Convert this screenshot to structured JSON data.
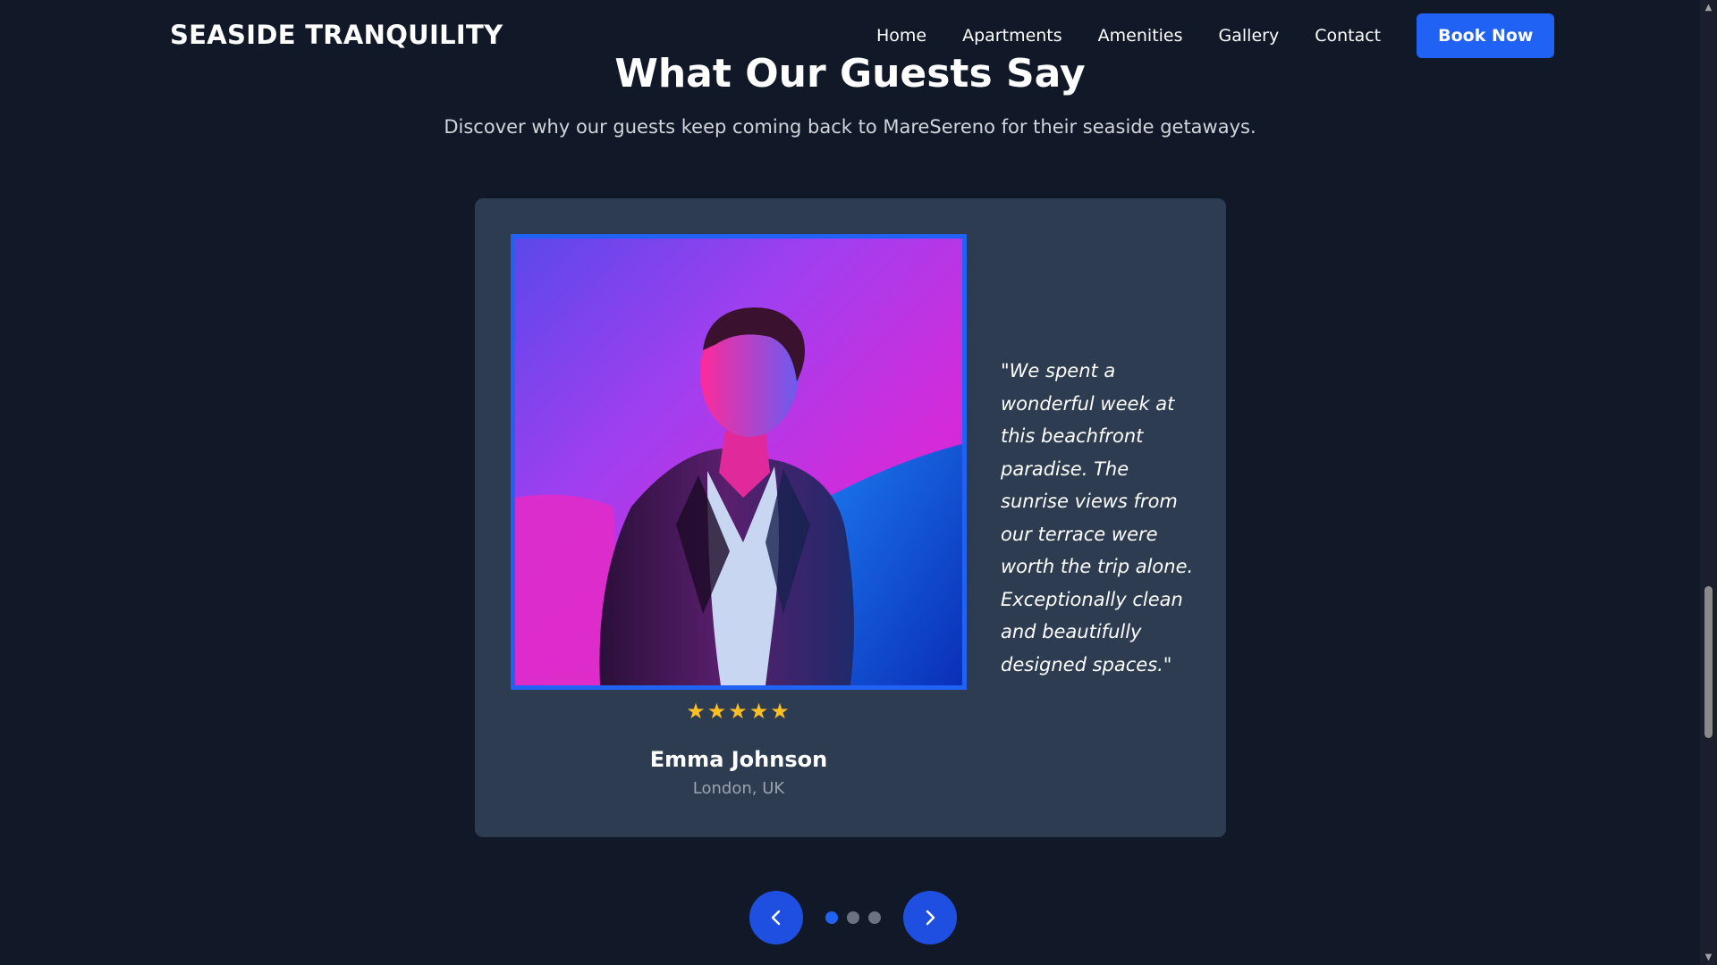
{
  "header": {
    "logo": "SEASIDE TRANQUILITY",
    "nav": [
      "Home",
      "Apartments",
      "Amenities",
      "Gallery",
      "Contact"
    ],
    "cta": "Book Now"
  },
  "section": {
    "title": "What Our Guests Say",
    "subtitle": "Discover why our guests keep coming back to MareSereno for their seaside getaways."
  },
  "testimonial": {
    "stars": "★★★★★",
    "rating": 5,
    "name": "Emma Johnson",
    "location": "London, UK",
    "quote": "\"We spent a wonderful week at this beachfront paradise. The sunrise views from our terrace were worth the trip alone. Exceptionally clean and beautifully designed spaces.\""
  },
  "carousel": {
    "slides": 3,
    "active_index": 0,
    "prev_icon": "chevron-left-icon",
    "next_icon": "chevron-right-icon"
  },
  "colors": {
    "background": "#111827",
    "card": "#2d3c50",
    "accent": "#1f62f4",
    "star": "#fbbf24",
    "muted_text": "#9ca3af"
  }
}
